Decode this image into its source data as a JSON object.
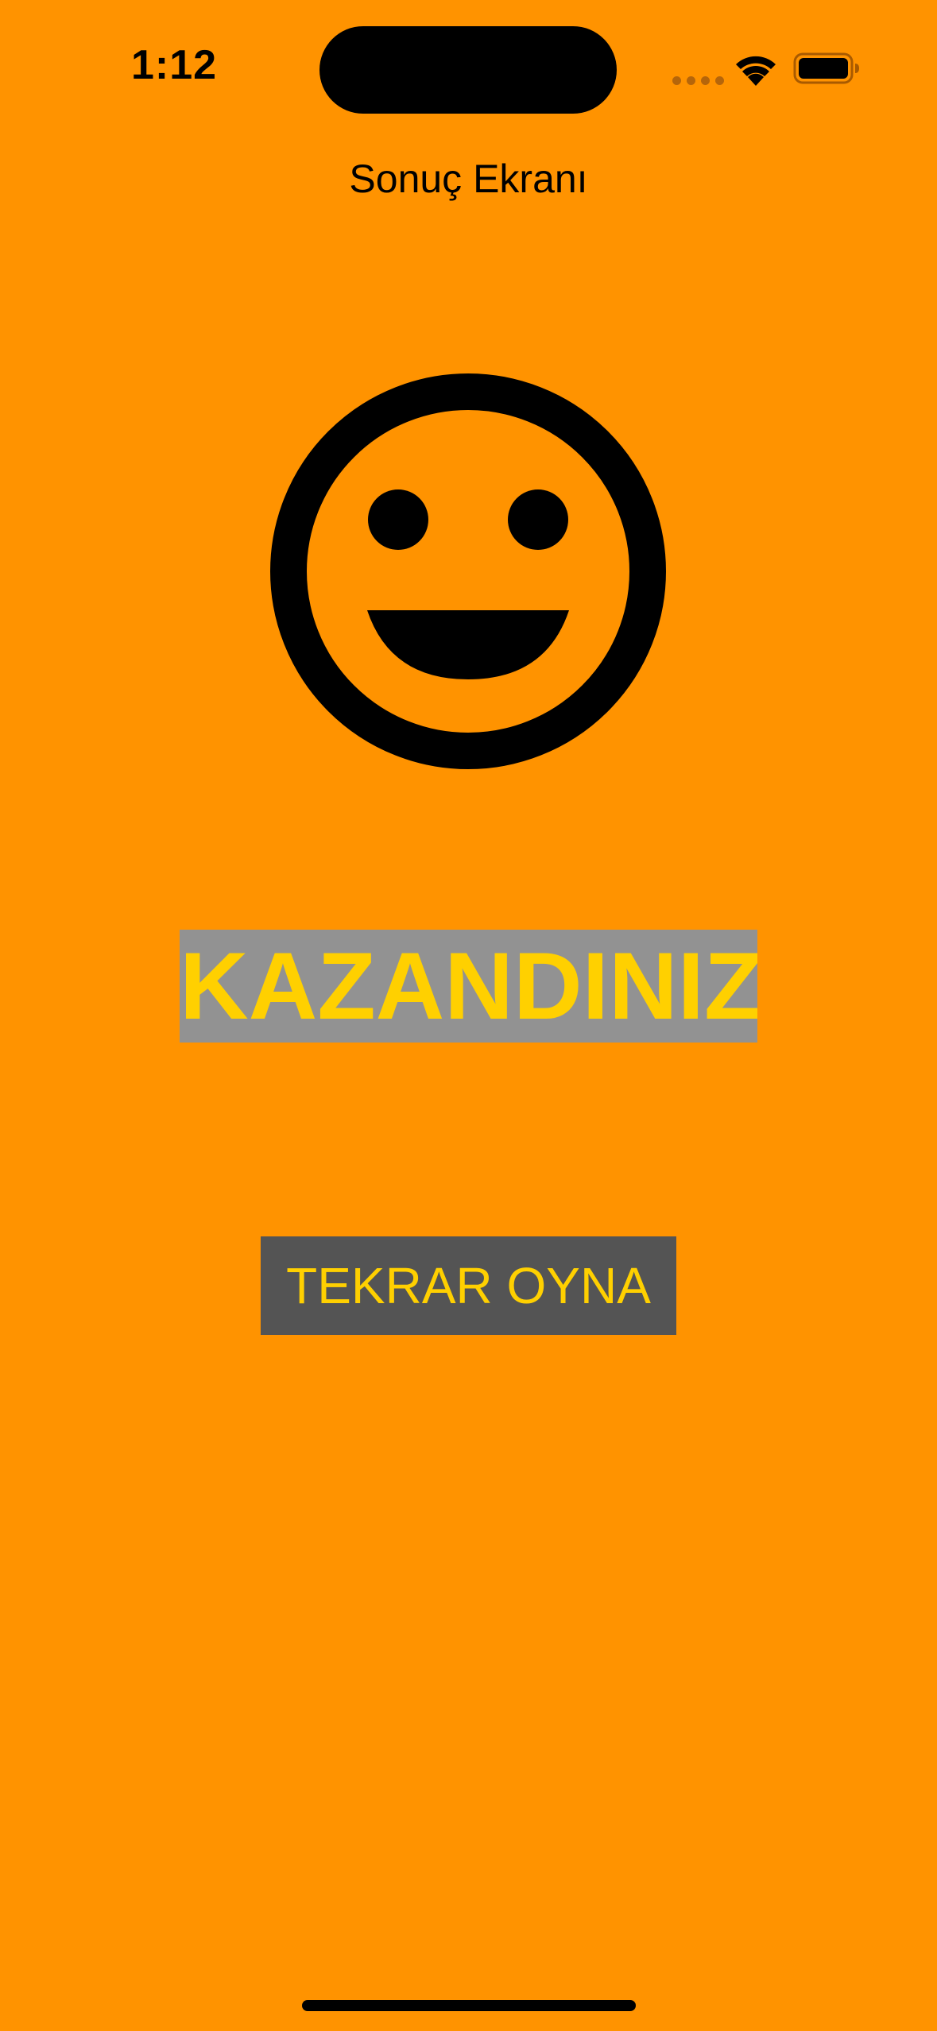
{
  "status_bar": {
    "time": "1:12",
    "icons": [
      "cellular-signal-icon",
      "wifi-icon",
      "battery-icon"
    ]
  },
  "navigation": {
    "title": "Sonuç Ekranı"
  },
  "result": {
    "icon": "smiley-face-icon",
    "label": "KAZANDINIZ"
  },
  "actions": {
    "replay_label": "TEKRAR OYNA"
  },
  "colors": {
    "background": "#FF9300",
    "label_background": "#929292",
    "button_background": "#545454",
    "accent_text": "#FFD000"
  }
}
